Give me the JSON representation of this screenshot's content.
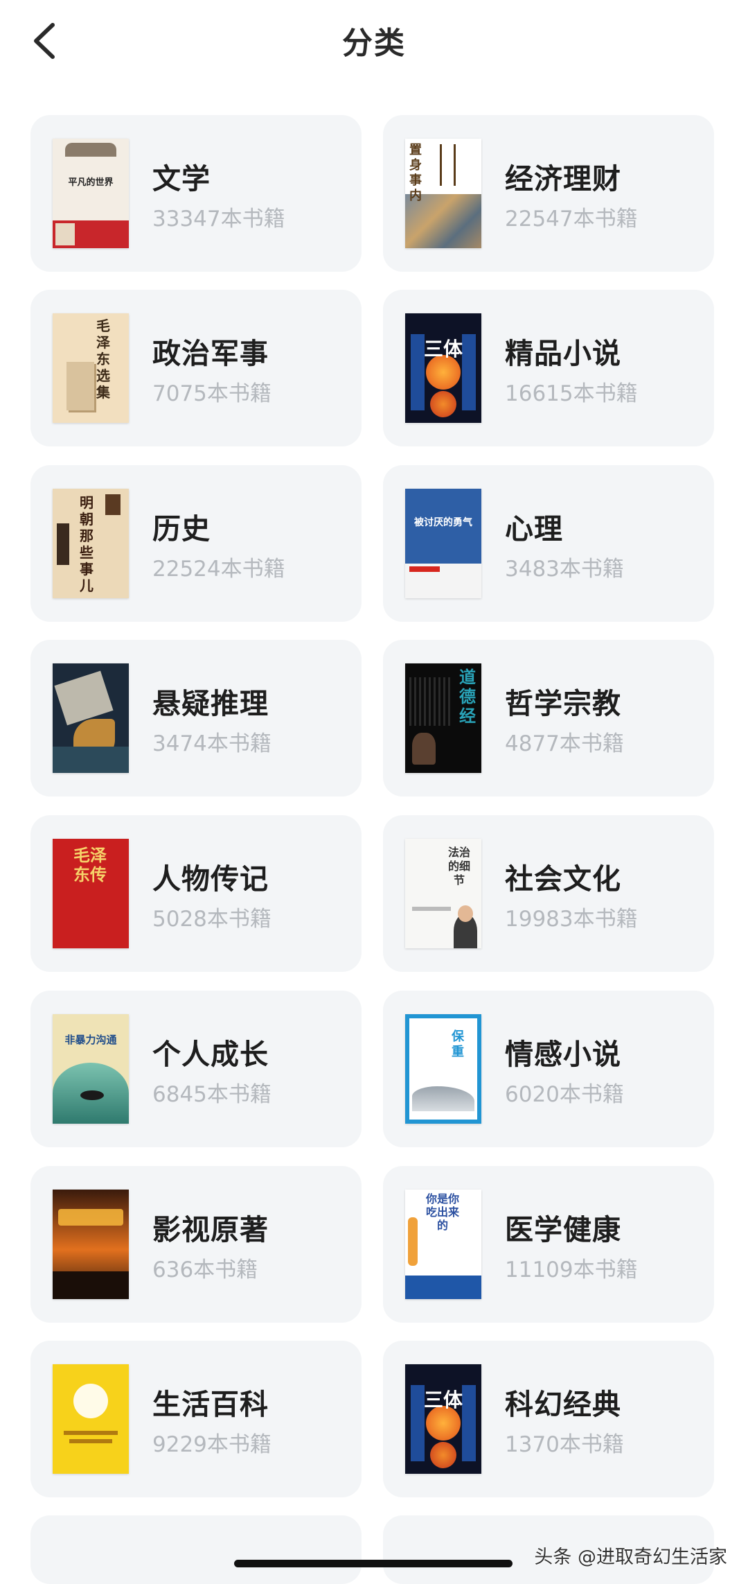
{
  "header": {
    "title": "分类"
  },
  "categories": [
    {
      "name": "文学",
      "count": "33347本书籍",
      "cover_text": "平凡的世界"
    },
    {
      "name": "经济理财",
      "count": "22547本书籍",
      "cover_text": "置身事内"
    },
    {
      "name": "政治军事",
      "count": "7075本书籍",
      "cover_text": "毛泽东选集"
    },
    {
      "name": "精品小说",
      "count": "16615本书籍",
      "cover_text": "三体"
    },
    {
      "name": "历史",
      "count": "22524本书籍",
      "cover_text": "明朝那些事儿"
    },
    {
      "name": "心理",
      "count": "3483本书籍",
      "cover_text": "被讨厌的勇气"
    },
    {
      "name": "悬疑推理",
      "count": "3474本书籍",
      "cover_text": ""
    },
    {
      "name": "哲学宗教",
      "count": "4877本书籍",
      "cover_text": "道德经"
    },
    {
      "name": "人物传记",
      "count": "5028本书籍",
      "cover_text": "毛泽东传"
    },
    {
      "name": "社会文化",
      "count": "19983本书籍",
      "cover_text": "法治的细节"
    },
    {
      "name": "个人成长",
      "count": "6845本书籍",
      "cover_text": "非暴力沟通"
    },
    {
      "name": "情感小说",
      "count": "6020本书籍",
      "cover_text": "保重"
    },
    {
      "name": "影视原著",
      "count": "636本书籍",
      "cover_text": ""
    },
    {
      "name": "医学健康",
      "count": "11109本书籍",
      "cover_text": "你是你吃出来的"
    },
    {
      "name": "生活百科",
      "count": "9229本书籍",
      "cover_text": ""
    },
    {
      "name": "科幻经典",
      "count": "1370本书籍",
      "cover_text": "三体"
    }
  ],
  "watermark": "头条 @进取奇幻生活家",
  "icons": {
    "back": "chevron-left-icon"
  }
}
